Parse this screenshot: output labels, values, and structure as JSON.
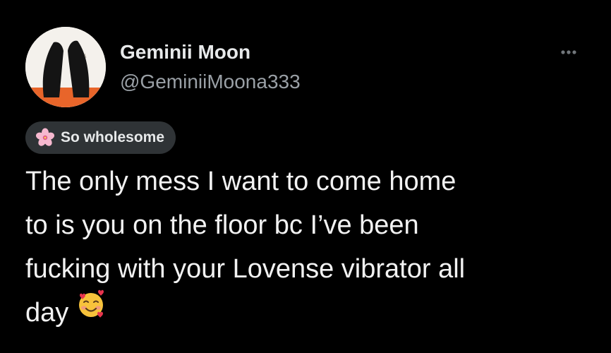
{
  "author": {
    "display_name": "Geminii Moon",
    "handle": "@GeminiiMoona333",
    "avatar_icon": "profile-photo-icon"
  },
  "more_icon": "more-options-icon",
  "badge": {
    "icon": "cherry-blossom-icon",
    "label": "So wholesome"
  },
  "tweet": {
    "lines": [
      "The only mess I want to come home",
      "to is you on the floor bc I’ve been",
      "fucking with your Lovense vibrator all",
      "day"
    ],
    "emoji": "smiling-face-with-hearts-emoji"
  },
  "colors": {
    "background": "#000000",
    "text_primary": "#e7e9ea",
    "text_secondary": "#9aa0a6",
    "badge_background": "#2f3336"
  }
}
